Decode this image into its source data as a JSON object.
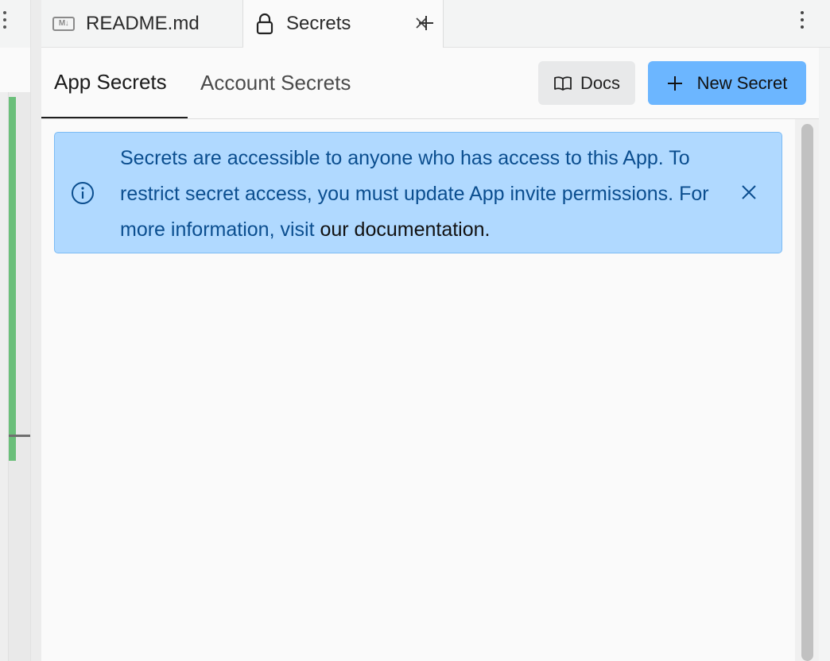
{
  "tabs": [
    {
      "label": "README.md",
      "icon": "markdown-icon",
      "icon_text": "M↓"
    },
    {
      "label": "Secrets",
      "icon": "lock-icon",
      "active": true
    }
  ],
  "panel": {
    "subtabs": [
      {
        "label": "App Secrets",
        "active": true
      },
      {
        "label": "Account Secrets"
      }
    ],
    "docs_button": "Docs",
    "new_secret_button": "New Secret"
  },
  "banner": {
    "text": "Secrets are accessible to anyone who has access to this App. To restrict secret access, you must update App invite permissions. For more information, visit ",
    "link_text": "our documentation."
  },
  "colors": {
    "accent_button": "#6cb6ff",
    "banner_bg": "#b0d9ff",
    "banner_text": "#0b4e8f",
    "left_indicator": "#6bbf7a"
  }
}
